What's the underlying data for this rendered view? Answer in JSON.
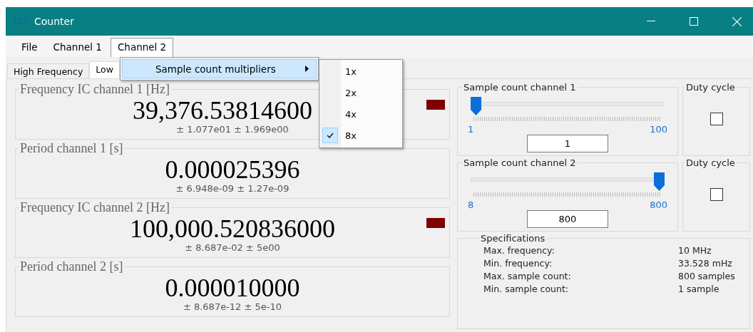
{
  "window": {
    "title": "Counter"
  },
  "menu": [
    {
      "label": "File",
      "selected": false
    },
    {
      "label": "Channel 1",
      "selected": false
    },
    {
      "label": "Channel 2",
      "selected": true
    }
  ],
  "dropdown": {
    "label": "Sample count multipliers",
    "selected": true
  },
  "submenu": [
    {
      "label": "1x",
      "checked": false
    },
    {
      "label": "2x",
      "checked": false
    },
    {
      "label": "4x",
      "checked": false
    },
    {
      "label": "8x",
      "checked": true
    }
  ],
  "tabs": [
    {
      "label": "High Frequency",
      "selected": false
    },
    {
      "label": "Low",
      "selected": true
    }
  ],
  "measurements": [
    {
      "title": "Frequency IC channel 1 [Hz]",
      "value": "39,376.53814600",
      "error": "± 1.077e01 ± 1.969e00",
      "indicator": true
    },
    {
      "title": "Period channel 1 [s]",
      "value": "0.000025396",
      "error": "± 6.948e-09 ± 1.27e-09",
      "indicator": false
    },
    {
      "title": "Frequency IC channel 2 [Hz]",
      "value": "100,000.520836000",
      "error": "± 8.687e-02 ± 5e00",
      "indicator": true
    },
    {
      "title": "Period channel 2 [s]",
      "value": "0.000010000",
      "error": "± 8.687e-12 ± 5e-10",
      "indicator": false
    }
  ],
  "sample_counts": [
    {
      "title": "Sample count channel 1",
      "level": 0,
      "min": "1",
      "max": "100",
      "value": "1",
      "duty_title": "Duty cycle",
      "duty_checked": false
    },
    {
      "title": "Sample count channel 2",
      "level": 1,
      "min": "8",
      "max": "800",
      "value": "800",
      "duty_title": "Duty cycle",
      "duty_checked": false
    }
  ],
  "specifications": {
    "title": "Specifications",
    "rows": [
      {
        "label": "Max. frequency:",
        "value": "10 MHz"
      },
      {
        "label": "Min. frequency:",
        "value": "33.528 mHz"
      },
      {
        "label": "Max. sample count:",
        "value": "800 samples"
      },
      {
        "label": "Min. sample count:",
        "value": "1 sample"
      }
    ]
  }
}
